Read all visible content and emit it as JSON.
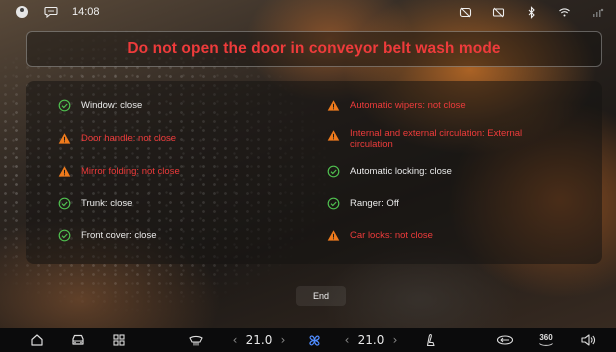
{
  "status_bar": {
    "time": "14:08",
    "left_icons": [
      "user-avatar-icon",
      "chat-bubble-icon"
    ],
    "right_icons": [
      "camera-off-icon",
      "screen-off-icon",
      "bluetooth-icon",
      "wifi-icon",
      "signal-icon"
    ]
  },
  "banner": {
    "message": "Do not open the door in conveyor belt wash mode"
  },
  "checks": {
    "left": [
      {
        "label": "Window: close",
        "status": "ok"
      },
      {
        "label": "Door handle: not close",
        "status": "warn"
      },
      {
        "label": "Mirror folding: not close",
        "status": "warn"
      },
      {
        "label": "Trunk: close",
        "status": "ok"
      },
      {
        "label": "Front cover: close",
        "status": "ok"
      }
    ],
    "right": [
      {
        "label": "Automatic wipers: not close",
        "status": "warn"
      },
      {
        "label": "Internal and external circulation: External circulation",
        "status": "warn"
      },
      {
        "label": "Automatic locking: close",
        "status": "ok"
      },
      {
        "label": "Ranger: Off",
        "status": "ok"
      },
      {
        "label": "Car locks: not close",
        "status": "warn"
      }
    ]
  },
  "end_button": {
    "label": "End"
  },
  "dock": {
    "left_temp": "21.0",
    "right_temp": "21.0",
    "view_360": "360",
    "icons": [
      "home-icon",
      "car-icon",
      "apps-grid-icon",
      "defrost-icon",
      "fan-icon",
      "seat-icon",
      "vehicle-icon",
      "camera-360-icon",
      "volume-icon"
    ]
  },
  "colors": {
    "ok": "#4fbf4f",
    "warn": "#ee7a1c",
    "warn_text": "#ee3b3b",
    "banner_text": "#ee3b3b",
    "fan_accent": "#4f8cff"
  }
}
